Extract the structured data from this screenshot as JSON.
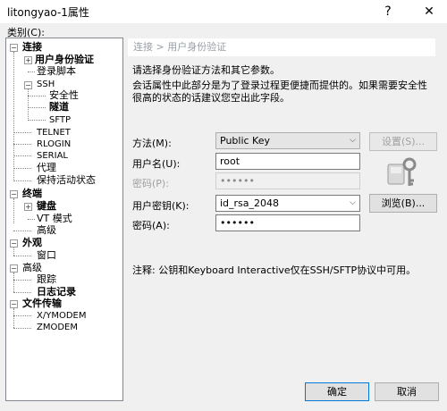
{
  "window": {
    "title": "litongyao-1属性",
    "help_label": "?",
    "close_label": "✕"
  },
  "category_label": "类别(C):",
  "tree": {
    "connection": "连接",
    "user_auth": "用户身份验证",
    "login_script": "登录脚本",
    "ssh": "SSH",
    "security": "安全性",
    "tunnel": "隧道",
    "sftp": "SFTP",
    "telnet": "TELNET",
    "rlogin": "RLOGIN",
    "serial": "SERIAL",
    "proxy": "代理",
    "keepalive": "保持活动状态",
    "terminal": "终端",
    "keyboard": "键盘",
    "vt_mode": "VT 模式",
    "advanced_term": "高级",
    "appearance": "外观",
    "window": "窗口",
    "advanced": "高级",
    "trace": "跟踪",
    "logging": "日志记录",
    "file_transfer": "文件传输",
    "xymodem": "X/YMODEM",
    "zmodem": "ZMODEM"
  },
  "header": "连接 > 用户身份验证",
  "intro1": "请选择身份验证方法和其它参数。",
  "intro2a": "会话属性中此部分是为了登录过程更便捷而提供的。如果需要安全性",
  "intro2b": "很高的状态的话建议您空出此字段。",
  "method": {
    "label": "方法(M):",
    "value": "Public Key",
    "settings_button": "设置(S)..."
  },
  "username": {
    "label": "用户名(U):",
    "value": "root"
  },
  "password_top": {
    "label": "密码(P):",
    "value": "••••••"
  },
  "user_key": {
    "label": "用户密钥(K):",
    "value": "id_rsa_2048",
    "browse_button": "浏览(B)..."
  },
  "password": {
    "label": "密码(A):",
    "value": "••••••"
  },
  "note": "注释: 公钥和Keyboard Interactive仅在SSH/SFTP协议中可用。",
  "ok_button": "确定",
  "cancel_button": "取消"
}
